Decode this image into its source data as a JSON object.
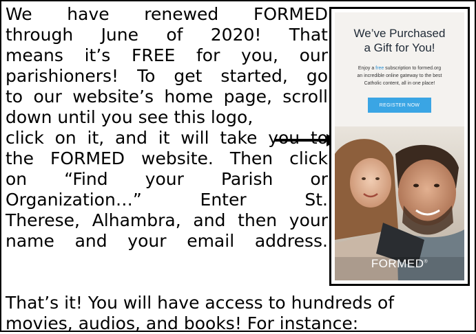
{
  "body_text": {
    "lines": [
      "We have renewed FORMED",
      "through June of 2020! That",
      "means it’s FREE for you, our",
      "parishioners! To get started, go",
      "to our website’s home page, scroll",
      "down until you see this logo,",
      "click on it, and it will take you to",
      "the FORMED website. Then click",
      "on “Find your Parish or",
      "Organization…” Enter St.",
      "Therese, Alhambra, and then your",
      "name and your email address."
    ],
    "full_lines": [
      "That’s it! You will have access to hundreds of",
      "movies, audios, and books! For instance:"
    ]
  },
  "ad": {
    "title_line1": "We’ve Purchased",
    "title_line2": "a Gift for You!",
    "sub_prefix": "Enjoy a ",
    "sub_free": "free",
    "sub_suffix": " subscription to formed.org",
    "sub_line2": "an incredible online gateway to the best",
    "sub_line3": "Catholic content, all in one place!",
    "button_label": "REGISTER NOW",
    "logo_text": "FORMED",
    "logo_mark": "®"
  },
  "colors": {
    "accent": "#3aa5e4",
    "free_link": "#2a8fd0",
    "title": "#1f2a36"
  }
}
